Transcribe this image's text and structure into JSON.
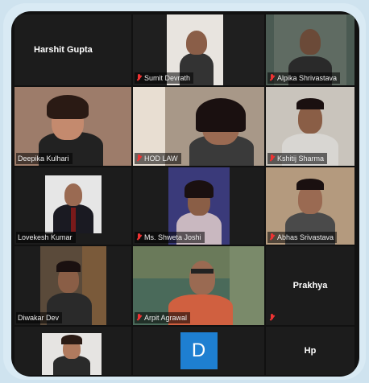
{
  "participants": [
    {
      "name": "Harshit Gupta",
      "kind": "name-only",
      "muted": false
    },
    {
      "name": "Sumit Devrath",
      "kind": "video",
      "muted": true,
      "bg": "#6b6b6b"
    },
    {
      "name": "Alpika Shrivastava",
      "kind": "video",
      "muted": true,
      "bg": "#4a5a52"
    },
    {
      "name": "Deepika Kulhari",
      "kind": "video",
      "muted": false,
      "bg": "#8a6e60"
    },
    {
      "name": "HOD LAW",
      "kind": "video",
      "muted": true,
      "bg": "#9a8c7e"
    },
    {
      "name": "Kshitij Sharma",
      "kind": "video",
      "muted": true,
      "bg": "#c9c4bc"
    },
    {
      "name": "Lovekesh Kumar",
      "kind": "video",
      "muted": false,
      "bg": "#e6e6e6"
    },
    {
      "name": "Ms. Shweta Joshi",
      "kind": "video",
      "muted": true,
      "bg": "#3a3a7a"
    },
    {
      "name": "Abhas Srivastava",
      "kind": "video",
      "muted": true,
      "bg": "#7a6a5a"
    },
    {
      "name": "Diwakar Dev",
      "kind": "video",
      "muted": false,
      "bg": "#5a4a3a"
    },
    {
      "name": "Arpit Agrawal",
      "kind": "video",
      "muted": true,
      "bg": "#4a6a5a"
    },
    {
      "name": "Prakhya",
      "kind": "name-only",
      "muted": true
    },
    {
      "name": "",
      "kind": "video",
      "muted": false,
      "bg": "#2a2a2a"
    },
    {
      "name": "",
      "kind": "avatar",
      "avatar_letter": "D",
      "muted": false
    },
    {
      "name": "Hp",
      "kind": "name-only",
      "muted": false
    }
  ],
  "colors": {
    "avatar": "#1e7fd1",
    "muted_icon": "#e33333"
  }
}
